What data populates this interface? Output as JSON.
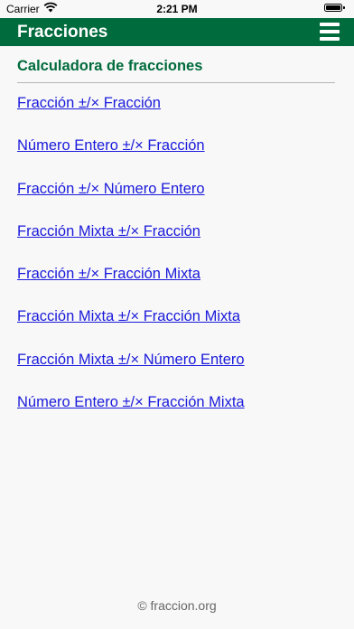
{
  "status_bar": {
    "carrier": "Carrier",
    "time": "2:21 PM"
  },
  "header": {
    "title": "Fracciones",
    "background_color": "#006b3c"
  },
  "main": {
    "page_title": "Calculadora de fracciones",
    "links": [
      {
        "label": "Fracción ±/× Fracción"
      },
      {
        "label": "Número Entero ±/× Fracción"
      },
      {
        "label": "Fracción ±/× Número Entero"
      },
      {
        "label": "Fracción Mixta ±/× Fracción"
      },
      {
        "label": "Fracción ±/× Fracción Mixta"
      },
      {
        "label": "Fracción Mixta ±/× Fracción Mixta"
      },
      {
        "label": "Fracción Mixta ±/× Número Entero"
      },
      {
        "label": "Número Entero ±/× Fracción Mixta"
      }
    ]
  },
  "footer": {
    "text": "© fraccion.org"
  },
  "icons": {
    "wifi": "wifi-icon",
    "battery": "battery-icon",
    "menu": "hamburger-menu-icon"
  }
}
